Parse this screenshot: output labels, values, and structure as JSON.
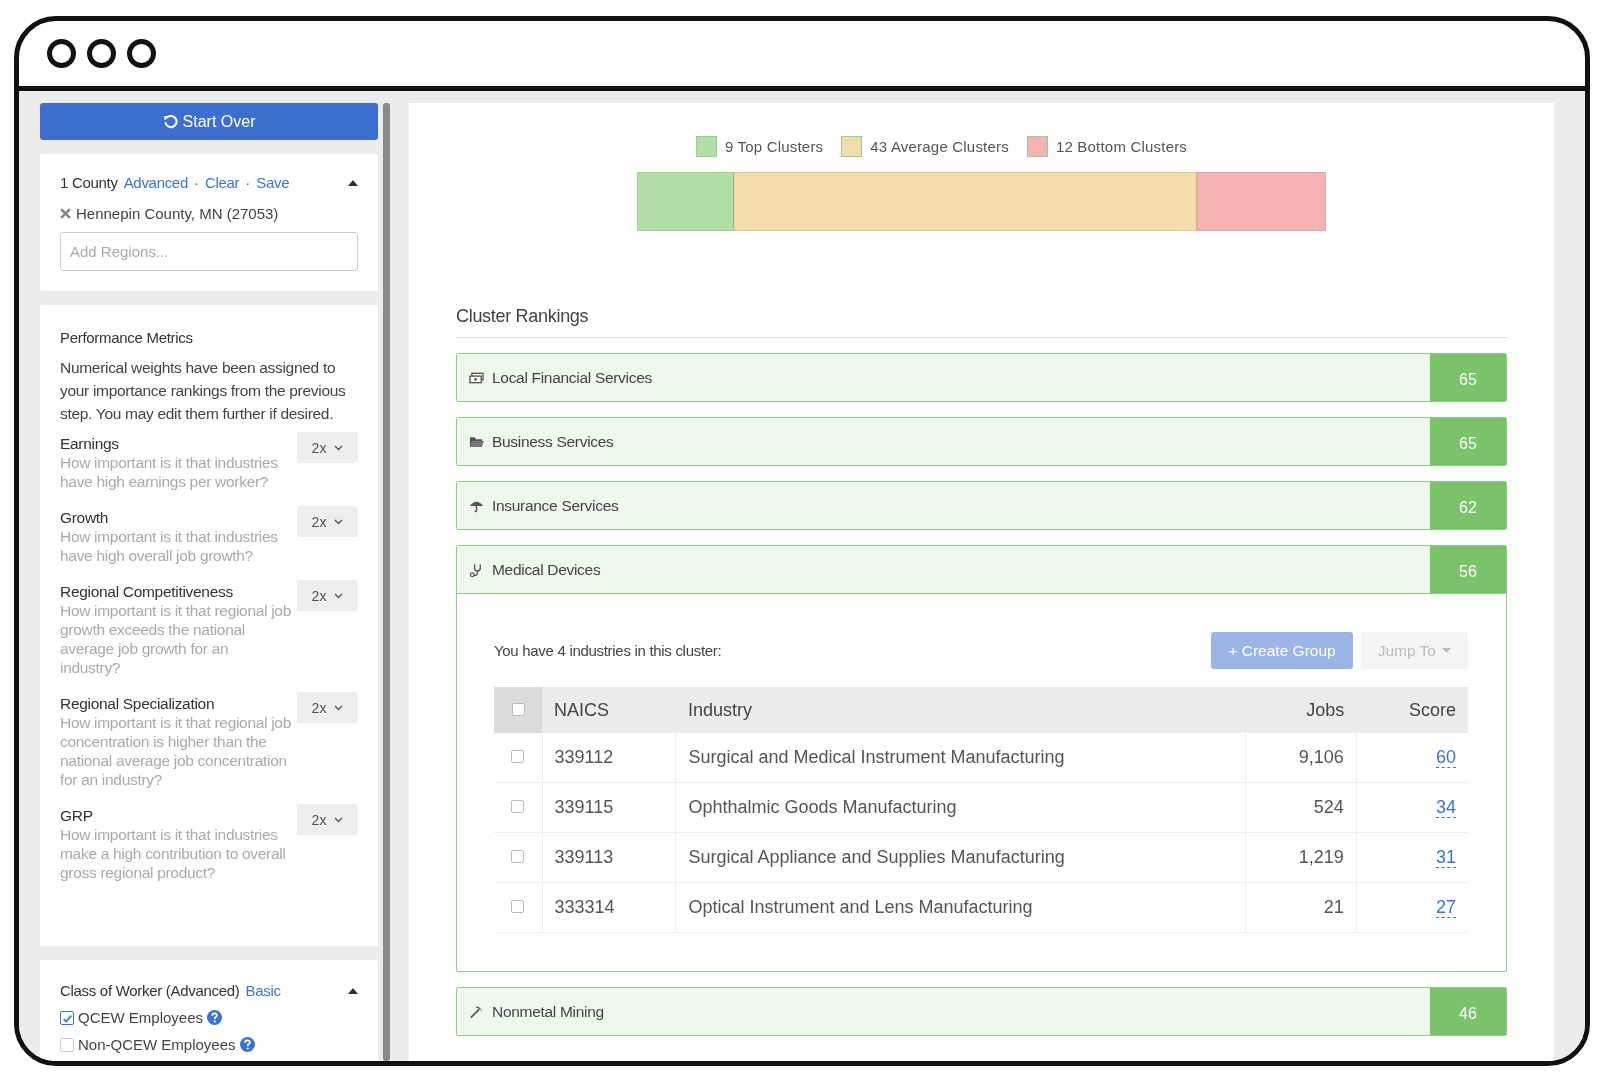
{
  "start_over": "Start Over",
  "region": {
    "title": "1 County",
    "links": [
      {
        "label": "Advanced"
      },
      {
        "separator": "·",
        "label": "Clear"
      },
      {
        "separator": "·",
        "label": "Save"
      }
    ],
    "expanded": true,
    "selected_region": "Hennepin County, MN (27053)",
    "placeholder": "Add Regions..."
  },
  "metrics": {
    "title": "Performance Metrics",
    "intro": "Numerical weights have been assigned to your importance rankings from the previous step. You may edit them further if desired.",
    "items": [
      {
        "name": "Earnings",
        "question": "How important is it that industries have high earnings per worker?",
        "weight": "2x"
      },
      {
        "name": "Growth",
        "question": "How important is it that industries have high overall job growth?",
        "weight": "2x"
      },
      {
        "name": "Regional Competitiveness",
        "question": "How important is it that regional job growth exceeds the national average job growth for an industry?",
        "weight": "2x"
      },
      {
        "name": "Regional Specialization",
        "question": "How important is it that regional job concentration is higher than the national average job concentration for an industry?",
        "weight": "2x"
      },
      {
        "name": "GRP",
        "question": "How important is it that industries make a high contribution to overall gross regional product?",
        "weight": "2x"
      }
    ]
  },
  "worker_class": {
    "title": "Class of Worker (Advanced)",
    "link": "Basic",
    "expanded": true,
    "options": [
      {
        "label": "QCEW Employees",
        "checked": true
      },
      {
        "label": "Non-QCEW Employees",
        "checked": false
      }
    ]
  },
  "legend": [
    {
      "count": "9",
      "label": "Top Clusters",
      "color": "#b2dfa6"
    },
    {
      "count": "43",
      "label": "Average Clusters",
      "color": "#f2dcaa"
    },
    {
      "count": "12",
      "label": "Bottom Clusters",
      "color": "#f7b3b3"
    }
  ],
  "rankings_title": "Cluster Rankings",
  "clusters": [
    {
      "name": "Local Financial Services",
      "kind": "money",
      "score": "65",
      "expanded": false
    },
    {
      "name": "Business Services",
      "kind": "folder",
      "score": "65",
      "expanded": false
    },
    {
      "name": "Insurance Services",
      "kind": "umbrella",
      "score": "62",
      "expanded": false
    },
    {
      "name": "Medical Devices",
      "kind": "stethoscope",
      "score": "56",
      "expanded": true,
      "detail": {
        "summary": "You have 4 industries in this cluster:",
        "create_group": "+ Create Group",
        "jump_to": "Jump To",
        "columns": [
          "NAICS",
          "Industry",
          "Jobs",
          "Score"
        ],
        "all_checked": false,
        "rows": [
          {
            "naics": "339112",
            "industry": "Surgical and Medical Instrument Manufacturing",
            "jobs": "9,106",
            "score": "60",
            "checked": false
          },
          {
            "naics": "339115",
            "industry": "Ophthalmic Goods Manufacturing",
            "jobs": "524",
            "score": "34",
            "checked": false
          },
          {
            "naics": "339113",
            "industry": "Surgical Appliance and Supplies Manufacturing",
            "jobs": "1,219",
            "score": "31",
            "checked": false
          },
          {
            "naics": "333314",
            "industry": "Optical Instrument and Lens Manufacturing",
            "jobs": "21",
            "score": "27",
            "checked": false
          }
        ]
      }
    },
    {
      "name": "Nonmetal Mining",
      "kind": "pick",
      "score": "46",
      "expanded": false
    }
  ]
}
